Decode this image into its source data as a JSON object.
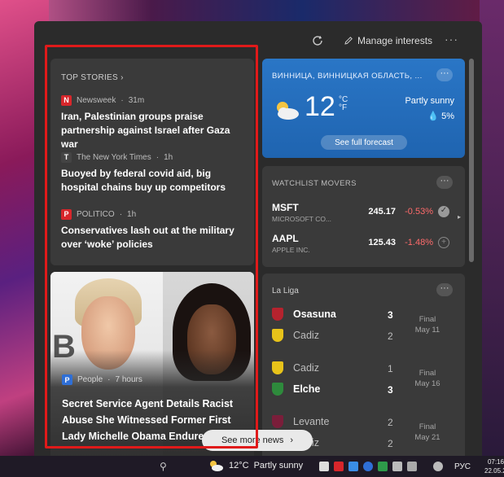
{
  "header": {
    "manage_label": "Manage interests",
    "more_label": "···"
  },
  "news": {
    "section_label": "TOP STORIES",
    "stories": [
      {
        "source": "Newsweek",
        "age": "31m",
        "logo": "N",
        "logo_color": "#d7262b",
        "title": "Iran, Palestinian groups praise partnership against Israel after Gaza war"
      },
      {
        "source": "The New York Times",
        "age": "1h",
        "logo": "T",
        "logo_color": "#444444",
        "title": "Buoyed by federal covid aid, big hospital chains buy up competitors"
      },
      {
        "source": "POLITICO",
        "age": "1h",
        "logo": "P",
        "logo_color": "#d7262b",
        "title": "Conservatives lash out at the military over ‘woke’ policies"
      }
    ],
    "feature": {
      "source": "People",
      "age": "7 hours",
      "logo": "P",
      "logo_color": "#2f6fd6",
      "title": "Secret Service Agent Details Racist Abuse She Witnessed Former First Lady Michelle Obama Endured",
      "photo_letter": "B"
    },
    "see_more_label": "See more news"
  },
  "weather": {
    "location": "ВИННИЦА, ВИННИЦКАЯ ОБЛАСТЬ, ...",
    "temperature": "12",
    "unit_c": "°C",
    "unit_f": "°F",
    "condition": "Partly sunny",
    "precip": "5%",
    "forecast_label": "See full forecast",
    "accent": "#2a76c6"
  },
  "watchlist": {
    "title": "WATCHLIST MOVERS",
    "stocks": [
      {
        "ticker": "MSFT",
        "company": "MICROSOFT CO...",
        "price": "245.17",
        "change": "-0.53%"
      },
      {
        "ticker": "AAPL",
        "company": "APPLE INC.",
        "price": "125.43",
        "change": "-1.48%"
      }
    ],
    "negative_color": "#ff6b6b"
  },
  "laliga": {
    "title": "La Liga",
    "matches": [
      {
        "home": "Osasuna",
        "home_score": "3",
        "away": "Cadiz",
        "away_score": "2",
        "status": "Final",
        "date": "May 11",
        "home_color": "#b5232e",
        "away_color": "#e8c31a"
      },
      {
        "home": "Cadiz",
        "home_score": "1",
        "away": "Elche",
        "away_score": "3",
        "status": "Final",
        "date": "May 16",
        "home_color": "#e8c31a",
        "away_color": "#2e8a3c"
      },
      {
        "home": "Levante",
        "home_score": "2",
        "away": "Cadiz",
        "away_score": "2",
        "status": "Final",
        "date": "May 21",
        "home_color": "#7a1e3a",
        "away_color": "#e8c31a"
      }
    ]
  },
  "taskbar": {
    "temperature": "12°C",
    "condition": "Partly sunny",
    "language": "РУС",
    "time": "07:16",
    "date": "22.05.2"
  }
}
